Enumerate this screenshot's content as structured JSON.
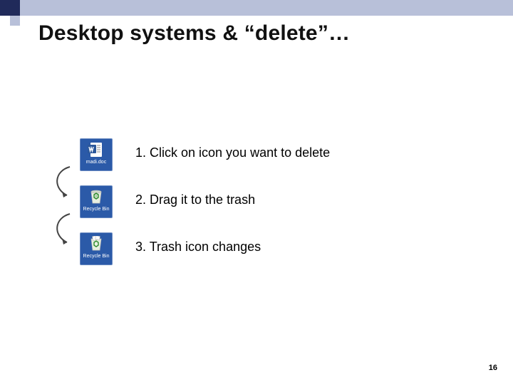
{
  "title": "Desktop systems & “delete”…",
  "steps": [
    {
      "text": "1. Click on icon you want to delete",
      "icon_name": "word-document-icon",
      "icon_label": "madi.doc"
    },
    {
      "text": "2. Drag it to the trash",
      "icon_name": "recycle-bin-empty-icon",
      "icon_label": "Recycle Bin"
    },
    {
      "text": "3. Trash icon changes",
      "icon_name": "recycle-bin-full-icon",
      "icon_label": "Recycle Bin"
    }
  ],
  "page_number": "16"
}
